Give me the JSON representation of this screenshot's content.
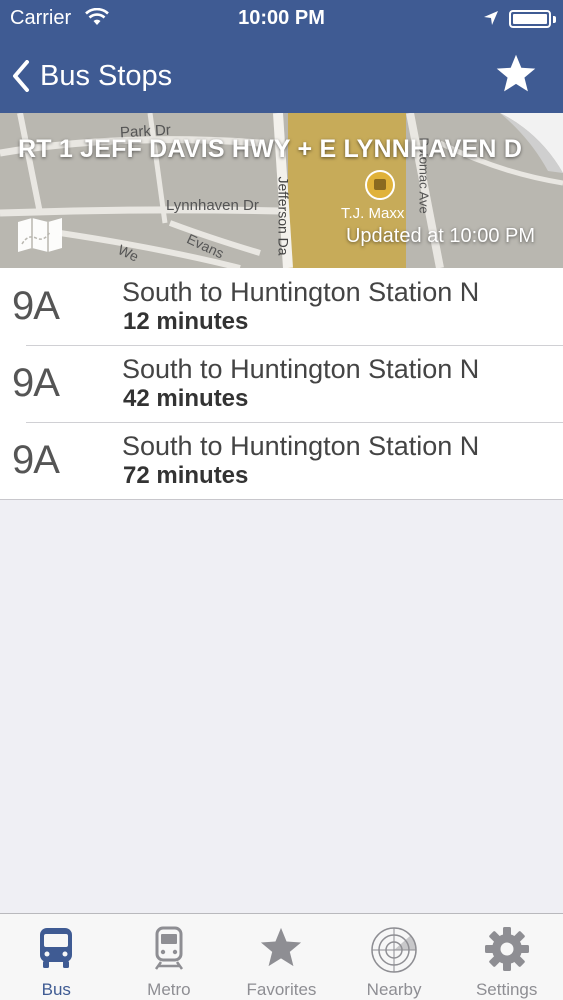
{
  "status": {
    "carrier": "Carrier",
    "time": "10:00 PM"
  },
  "nav": {
    "back_label": "Bus Stops"
  },
  "stop": {
    "title": "RT 1 JEFF DAVIS HWY + E LYNNHAVEN D",
    "updated": "Updated at 10:00 PM"
  },
  "map_labels": {
    "park_dr": "Park Dr",
    "lynnhaven_dr": "Lynnhaven Dr",
    "evans": "Evans",
    "jefferson": "Jefferson Da",
    "tjmaxx": "T.J. Maxx",
    "potomac": "Potomac Ave",
    "we": "We"
  },
  "arrivals": [
    {
      "route": "9A",
      "destination": "South to Huntington Station N",
      "eta": "12 minutes"
    },
    {
      "route": "9A",
      "destination": "South to Huntington Station N",
      "eta": "42 minutes"
    },
    {
      "route": "9A",
      "destination": "South to Huntington Station N",
      "eta": "72 minutes"
    }
  ],
  "tabs": [
    {
      "label": "Bus",
      "icon": "bus-icon"
    },
    {
      "label": "Metro",
      "icon": "train-icon"
    },
    {
      "label": "Favorites",
      "icon": "star-icon"
    },
    {
      "label": "Nearby",
      "icon": "radar-icon"
    },
    {
      "label": "Settings",
      "icon": "gear-icon"
    }
  ],
  "colors": {
    "accent": "#3f5b93",
    "tab_inactive": "#8e8e93",
    "background": "#efeff4"
  }
}
